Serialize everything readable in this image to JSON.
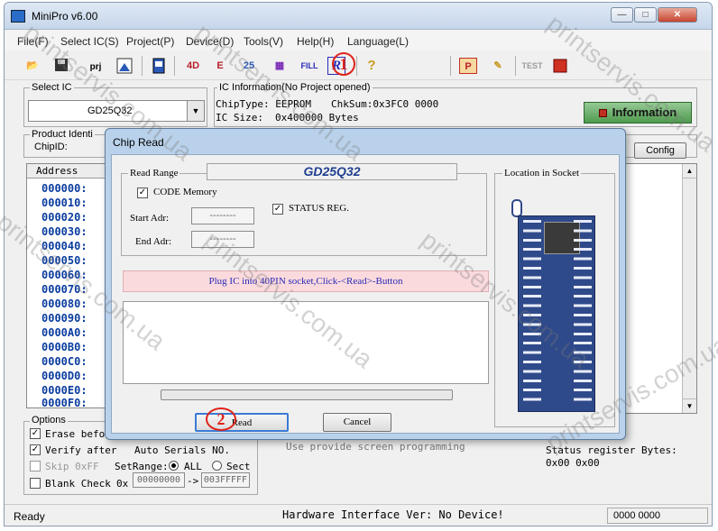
{
  "window": {
    "title": "MiniPro v6.00"
  },
  "menu": [
    "File(F)",
    "Select IC(S)",
    "Project(P)",
    "Device(D)",
    "Tools(V)",
    "Help(H)",
    "Language(L)"
  ],
  "toolbar": {
    "prj_label": "prj",
    "fill_label": "FILL",
    "test_label": "TEST",
    "help_glyph": "?"
  },
  "select_ic": {
    "label": "Select IC",
    "value": "GD25Q32"
  },
  "ic_info": {
    "label": "IC Information(No Project opened)",
    "chip_type": "ChipType:  EEPROM",
    "chk_sum": "ChkSum:0x3FC0 0000",
    "ic_size_label": "IC Size:",
    "ic_size_value": "0x400000 Bytes"
  },
  "information_button": "Information",
  "product_ident": {
    "label": "Product Identi",
    "chip_id_label": "ChipID:"
  },
  "config_button": "Config",
  "address_panel": {
    "header": "Address",
    "rows": [
      "000000:",
      "000010:",
      "000020:",
      "000030:",
      "000040:",
      "000050:",
      "000060:",
      "000070:",
      "000080:",
      "000090:",
      "0000A0:",
      "0000B0:",
      "0000C0:",
      "0000D0:",
      "0000E0:",
      "0000F0:"
    ]
  },
  "options": {
    "label": "Options",
    "erase_before": "Erase befor",
    "verify_after": "Verify after",
    "auto_serials": "Auto Serials NO.",
    "skip_0xff": "Skip 0xFF",
    "set_range": "SetRange:",
    "range_all": "ALL",
    "range_sect": "Sect",
    "blank_check": "Blank Check",
    "range_from_prefix": "0x",
    "range_from": "00000000",
    "range_arrow": "->",
    "range_to": "003FFFFF"
  },
  "background_line": "Use provide screen programming",
  "status_register": {
    "label": "Status register Bytes:",
    "values": "0x00 0x00"
  },
  "statusbar": {
    "left": "Ready",
    "center": "Hardware Interface Ver: No Device!",
    "right": "0000 0000"
  },
  "dialog": {
    "title": "Chip Read",
    "read_range_label": "Read Range",
    "chip_name": "GD25Q32",
    "code_memory": "CODE Memory",
    "start_adr_label": "Start Adr:",
    "start_adr_value": "--------",
    "end_adr_label": "End Adr:",
    "end_adr_value": "--------",
    "status_reg": "STATUS REG.",
    "message": "Plug IC into 40PIN socket,Click-<Read>-Button",
    "location_label": "Location in Socket",
    "read_button": "Read",
    "cancel_button": "Cancel"
  },
  "annotations": {
    "one": "1",
    "two": "2"
  },
  "watermark": "printservis.com.ua",
  "colors": {
    "accent": "#0a3c9e",
    "info_button": "#4f9a4f",
    "message_bg": "#fadadd",
    "annotation": "#e0231a"
  }
}
